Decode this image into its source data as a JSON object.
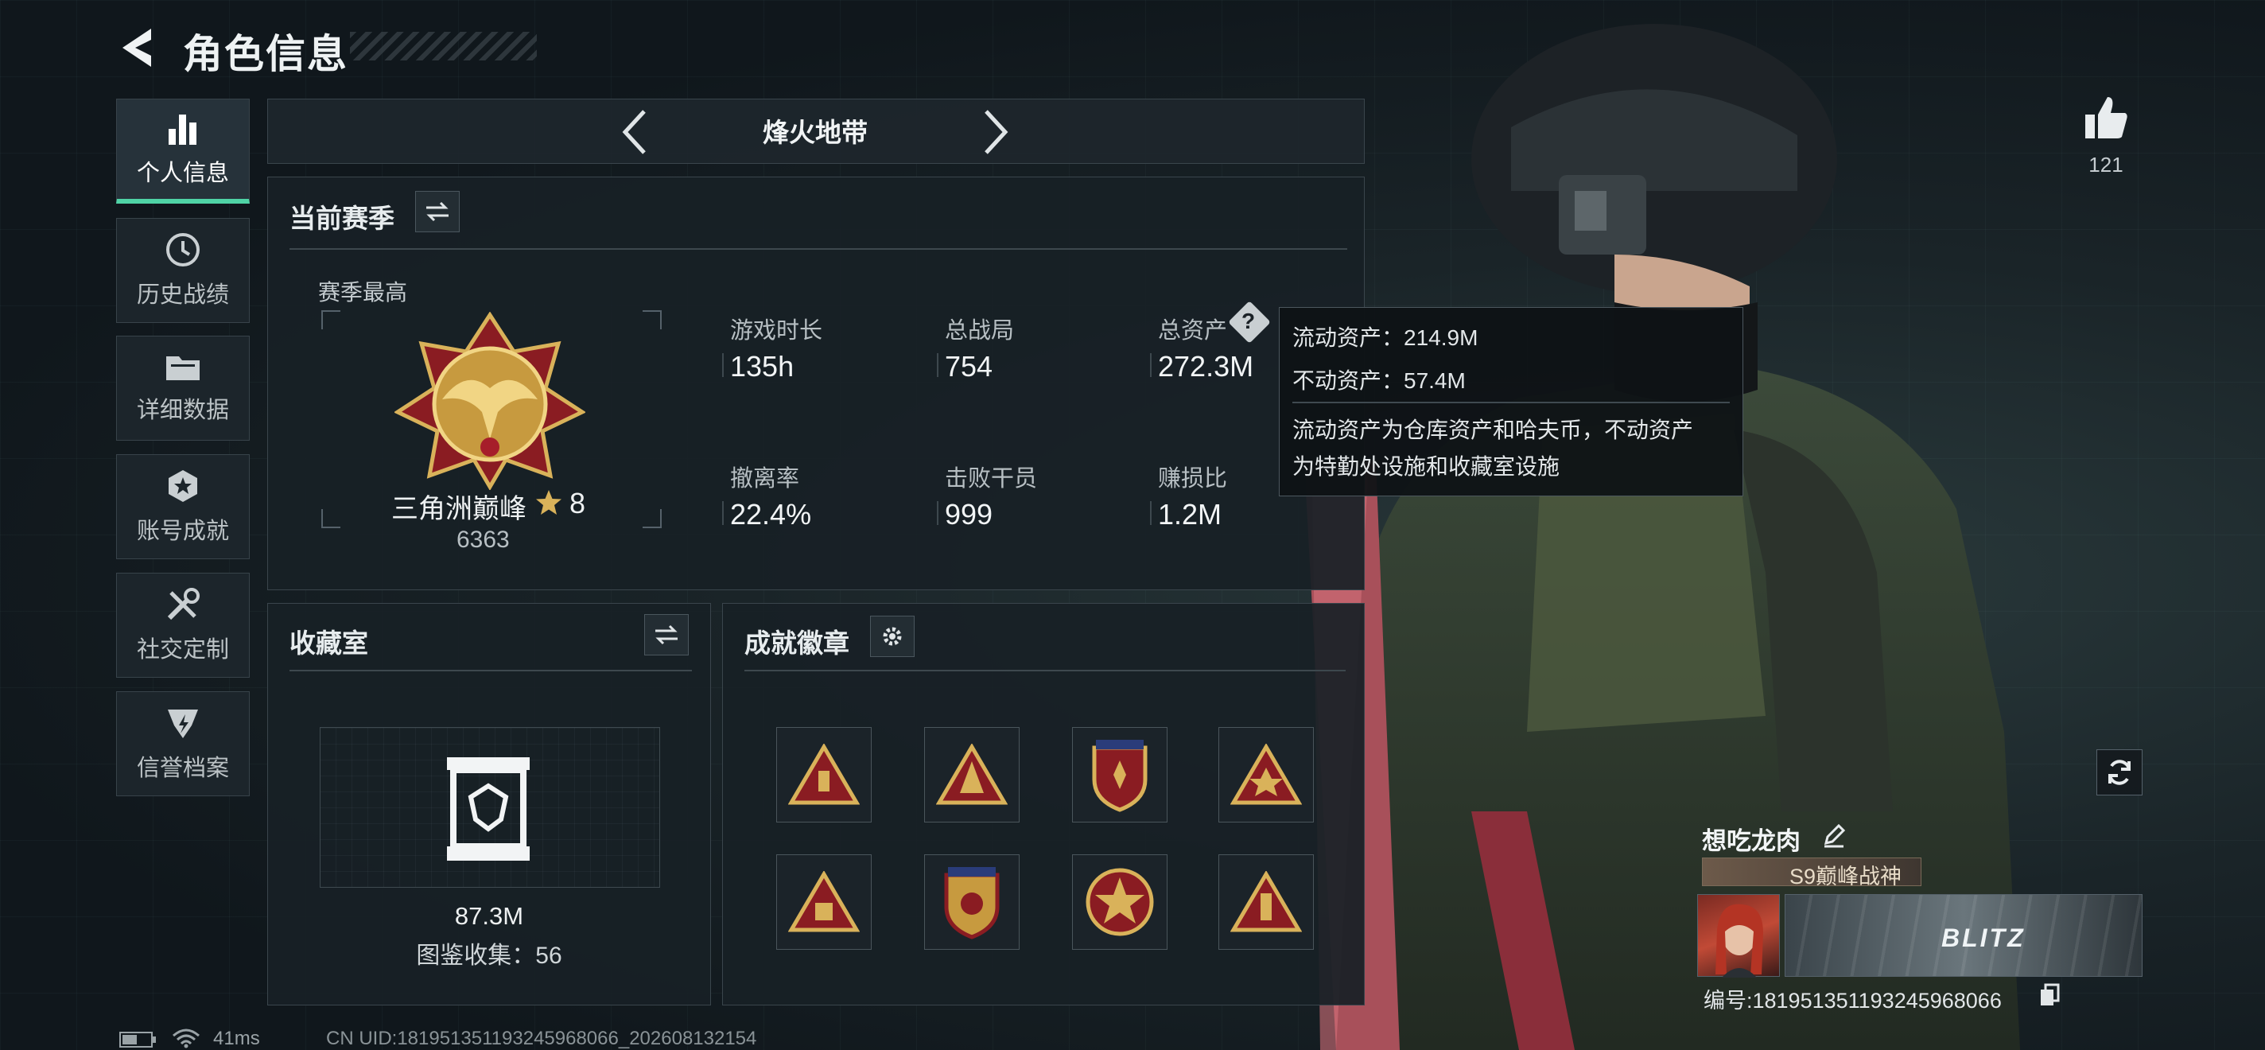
{
  "header": {
    "title": "角色信息"
  },
  "sidebar": {
    "items": [
      {
        "label": "个人信息",
        "icon": "bar-chart-icon"
      },
      {
        "label": "历史战绩",
        "icon": "history-clock-icon"
      },
      {
        "label": "详细数据",
        "icon": "folder-icon"
      },
      {
        "label": "账号成就",
        "icon": "achievement-icon"
      },
      {
        "label": "社交定制",
        "icon": "tools-icon"
      },
      {
        "label": "信誉档案",
        "icon": "reputation-icon"
      }
    ]
  },
  "mode_selector": {
    "label": "烽火地带"
  },
  "season": {
    "title": "当前赛季",
    "best_label": "赛季最高",
    "rank_name": "三角洲巅峰",
    "rank_stars": "8",
    "rank_score": "6363",
    "stats": [
      {
        "label": "游戏时长",
        "value": "135h"
      },
      {
        "label": "总战局",
        "value": "754"
      },
      {
        "label": "总资产",
        "value": "272.3M"
      },
      {
        "label": "撤离率",
        "value": "22.4%"
      },
      {
        "label": "击败干员",
        "value": "999"
      },
      {
        "label": "赚损比",
        "value": "1.2M"
      }
    ]
  },
  "tooltip": {
    "liquid": "流动资产：214.9M",
    "fixed": "不动资产：57.4M",
    "desc1": "流动资产为仓库资产和哈夫币，不动资产",
    "desc2": "为特勤处设施和收藏室设施"
  },
  "collection": {
    "title": "收藏室",
    "value": "87.3M",
    "count_label": "图鉴收集：56"
  },
  "badges": {
    "title": "成就徽章"
  },
  "player": {
    "likes": "121",
    "name": "想吃龙肉",
    "title_badge": "S9巅峰战神",
    "id_text": "编号:1819513511932459680​66",
    "banner_text": "BLITZ"
  },
  "status_bar": {
    "ping": "41ms",
    "uid": "CN UID:1819513511932459680​66_202608132154"
  },
  "colors": {
    "accent": "#4fd3a6",
    "gold": "#d9b25a",
    "badge_red": "#8a1c22"
  }
}
